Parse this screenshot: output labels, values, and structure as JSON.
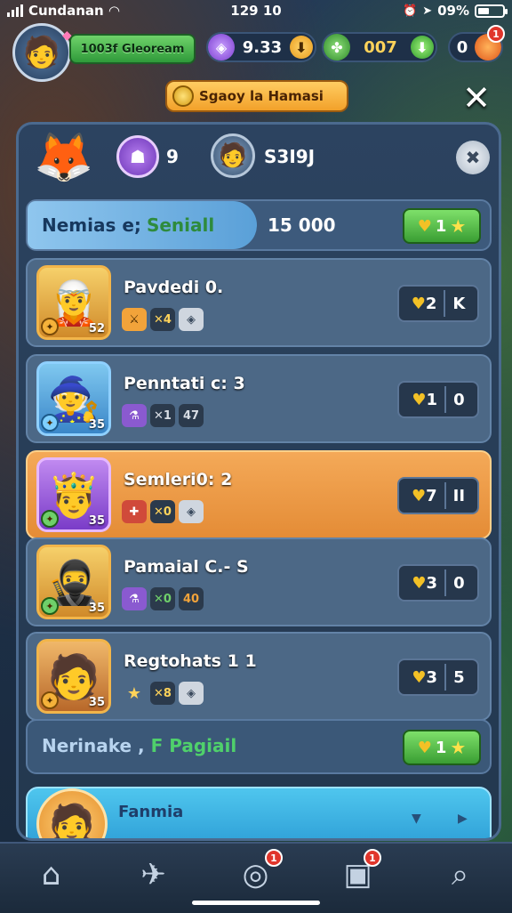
{
  "status": {
    "carrier": "Cundanan",
    "time": "129 10",
    "battery": "09%"
  },
  "hud": {
    "player_name": "1003f Gleoream",
    "res_purple": "9.33",
    "res_green": "007",
    "res_red": "0",
    "res_red_badge": "1"
  },
  "title": "Sgaoy la Hamasi",
  "panel": {
    "level": "9",
    "player_score": "S3I9J",
    "top_bar": {
      "label_a": "Nemias e;",
      "label_b": "Seniall",
      "amount": "15 000",
      "pill": "1"
    },
    "entries": [
      {
        "name": "Pavdedi 0.",
        "level": "52",
        "chips": [
          "",
          "4",
          ""
        ],
        "score": "2",
        "rank": "K"
      },
      {
        "name": "Penntati c: 3",
        "level": "35",
        "chips": [
          "",
          "1",
          "7"
        ],
        "score": "1",
        "rank": "0"
      },
      {
        "name": "Semleri0: 2",
        "level": "35",
        "chips": [
          "",
          "0",
          ""
        ],
        "score": "7",
        "rank": "II"
      },
      {
        "name": "Pamaial C.- S",
        "level": "35",
        "chips": [
          "",
          "0",
          "0"
        ],
        "score": "3",
        "rank": "0"
      },
      {
        "name": "Regtohats 1 1",
        "level": "35",
        "chips": [
          "",
          "8",
          ""
        ],
        "score": "3",
        "rank": "5"
      }
    ],
    "bottom_bar": {
      "label_a": "Nerinake ,",
      "label_b": "F Pagiail",
      "pill": "1"
    },
    "partial_entry": {
      "name": "Fanmia"
    }
  },
  "nav": {
    "badge_3": "1",
    "badge_4": "1"
  },
  "colors": {
    "highlight": "#e48c36",
    "accent_green": "#3a9e33"
  }
}
